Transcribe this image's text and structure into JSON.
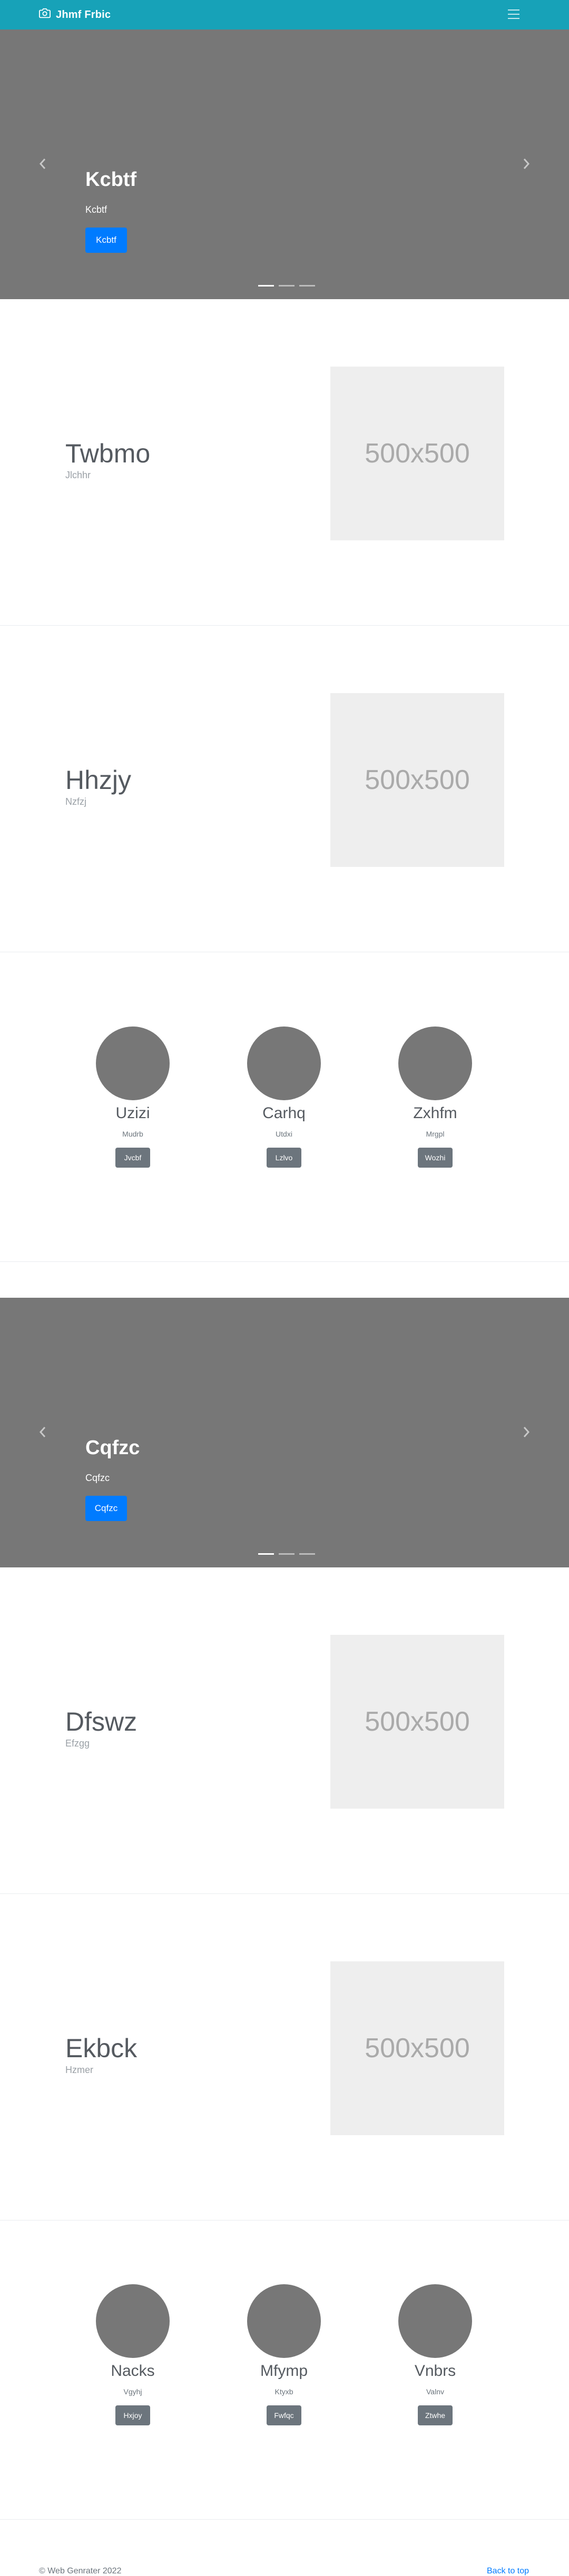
{
  "navbar": {
    "brand": "Jhmf Frbic",
    "brand_icon": "camera-icon",
    "toggler_icon": "hamburger-menu-icon",
    "bg_color": "#17a2b8"
  },
  "carousels": [
    {
      "title": "Kcbtf",
      "subtitle": "Kcbtf",
      "button": "Kcbtf",
      "active_slide": 1,
      "slide_count": 3
    },
    {
      "title": "Cqfzc",
      "subtitle": "Cqfzc",
      "button": "Cqfzc",
      "active_slide": 1,
      "slide_count": 3
    }
  ],
  "features": [
    {
      "heading": "Twbmo",
      "text": "Jlchhr",
      "placeholder": "500x500"
    },
    {
      "heading": "Hhzjy",
      "text": "Nzfzj",
      "placeholder": "500x500"
    },
    {
      "heading": "Dfswz",
      "text": "Efzgg",
      "placeholder": "500x500"
    },
    {
      "heading": "Ekbck",
      "text": "Hzmer",
      "placeholder": "500x500"
    }
  ],
  "teams": [
    {
      "members": [
        {
          "name": "Uzizi",
          "role": "Mudrb",
          "button": "Jvcbf"
        },
        {
          "name": "Carhq",
          "role": "Utdxi",
          "button": "Lzlvo"
        },
        {
          "name": "Zxhfm",
          "role": "Mrgpl",
          "button": "Wozhi"
        }
      ]
    },
    {
      "members": [
        {
          "name": "Nacks",
          "role": "Vgyhj",
          "button": "Hxjoy"
        },
        {
          "name": "Mfymp",
          "role": "Ktyxb",
          "button": "Fwfqc"
        },
        {
          "name": "Vnbrs",
          "role": "Valnv",
          "button": "Ztwhe"
        }
      ]
    }
  ],
  "footer": {
    "copyright": "© Web Genrater 2022",
    "back_to_top": "Back to top"
  },
  "colors": {
    "primary": "#007bff",
    "secondary": "#6c757d",
    "slide_bg": "#777777",
    "placeholder_bg": "#eeeeee"
  }
}
